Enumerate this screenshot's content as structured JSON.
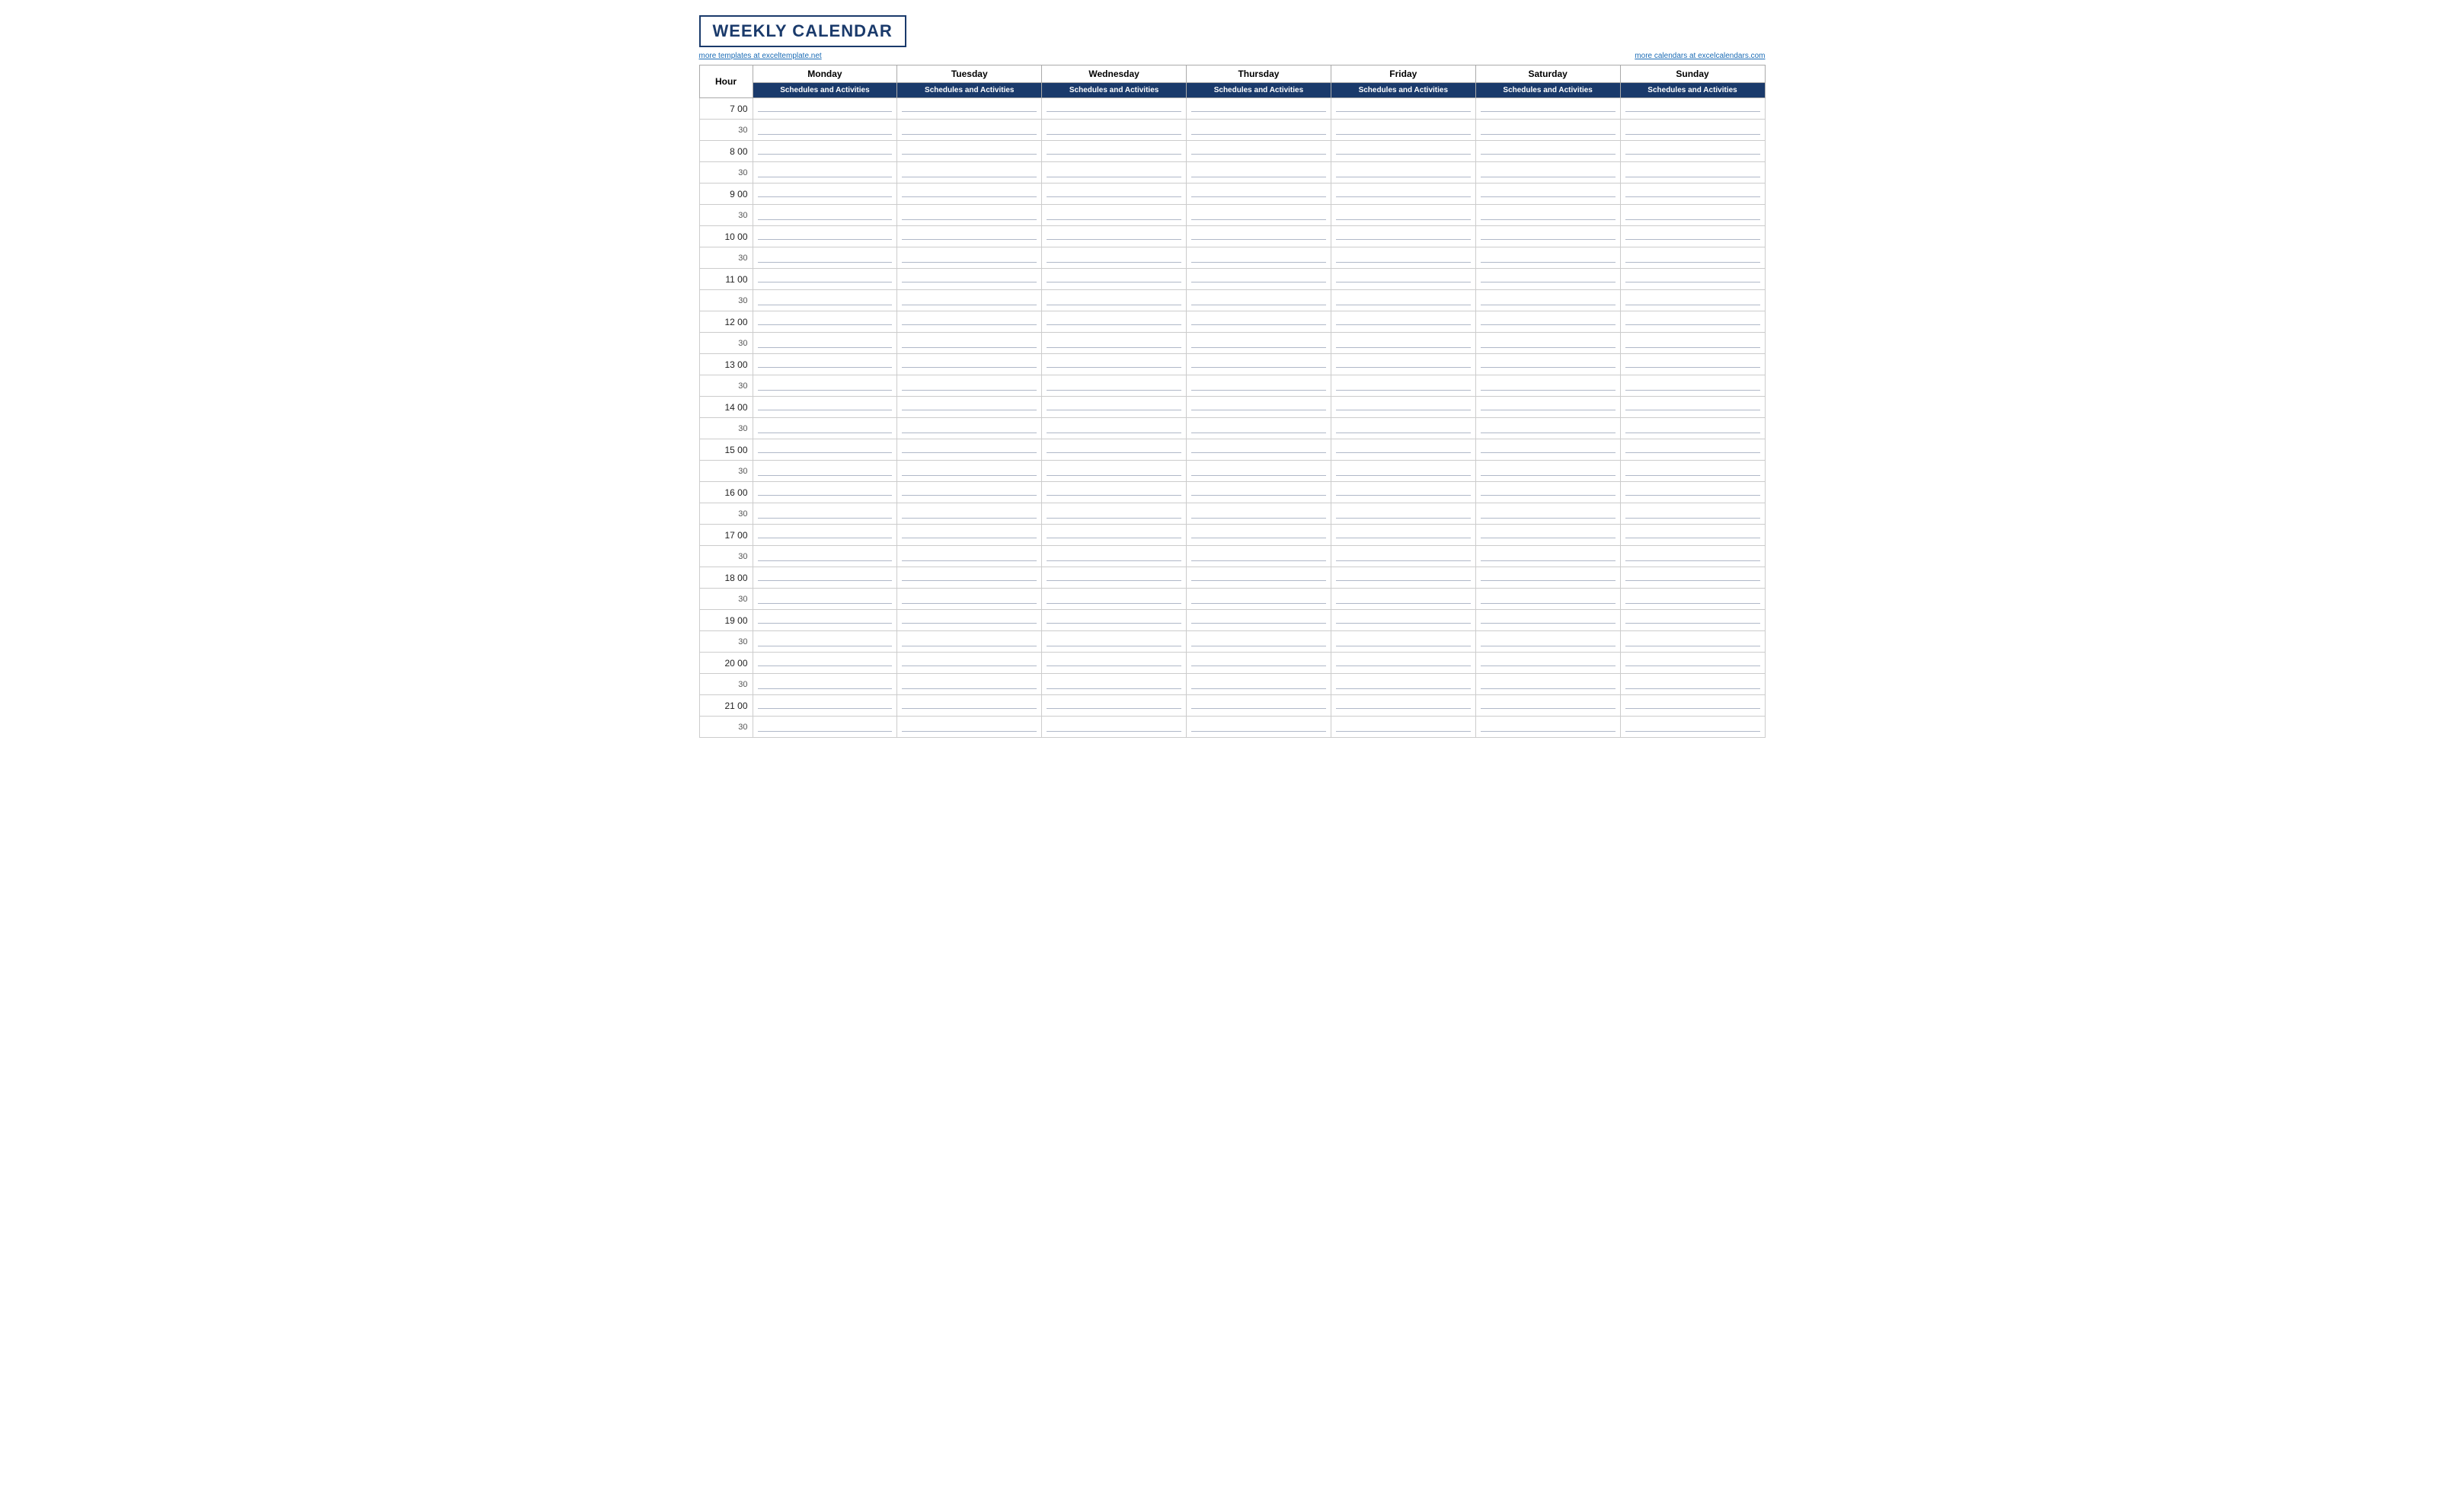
{
  "title": "WEEKLY CALENDAR",
  "link_left": "more templates at exceltemplate.net",
  "link_right": "more calendars at excelcalendars.com",
  "header_label": "Hour",
  "days": [
    {
      "name": "Monday",
      "sub": "Schedules and Activities"
    },
    {
      "name": "Tuesday",
      "sub": "Schedules and Activities"
    },
    {
      "name": "Wednesday",
      "sub": "Schedules and Activities"
    },
    {
      "name": "Thursday",
      "sub": "Schedules and Activities"
    },
    {
      "name": "Friday",
      "sub": "Schedules and Activities"
    },
    {
      "name": "Saturday",
      "sub": "Schedules and Activities"
    },
    {
      "name": "Sunday",
      "sub": "Schedules and Activities"
    }
  ],
  "hours": [
    {
      "label": "7  00",
      "half": "30"
    },
    {
      "label": "8  00",
      "half": "30"
    },
    {
      "label": "9  00",
      "half": "30"
    },
    {
      "label": "10  00",
      "half": "30"
    },
    {
      "label": "11  00",
      "half": "30"
    },
    {
      "label": "12  00",
      "half": "30"
    },
    {
      "label": "13  00",
      "half": "30"
    },
    {
      "label": "14  00",
      "half": "30"
    },
    {
      "label": "15  00",
      "half": "30"
    },
    {
      "label": "16  00",
      "half": "30"
    },
    {
      "label": "17  00",
      "half": "30"
    },
    {
      "label": "18  00",
      "half": "30"
    },
    {
      "label": "19  00",
      "half": "30"
    },
    {
      "label": "20  00",
      "half": "30"
    },
    {
      "label": "21  00",
      "half": "30"
    }
  ],
  "colors": {
    "title_color": "#1a3a6b",
    "header_bg": "#1a3a6b",
    "header_text": "#ffffff",
    "link_color": "#1a6bb5",
    "border_color": "#aaaaaa",
    "line_color": "#b0b8c8"
  }
}
